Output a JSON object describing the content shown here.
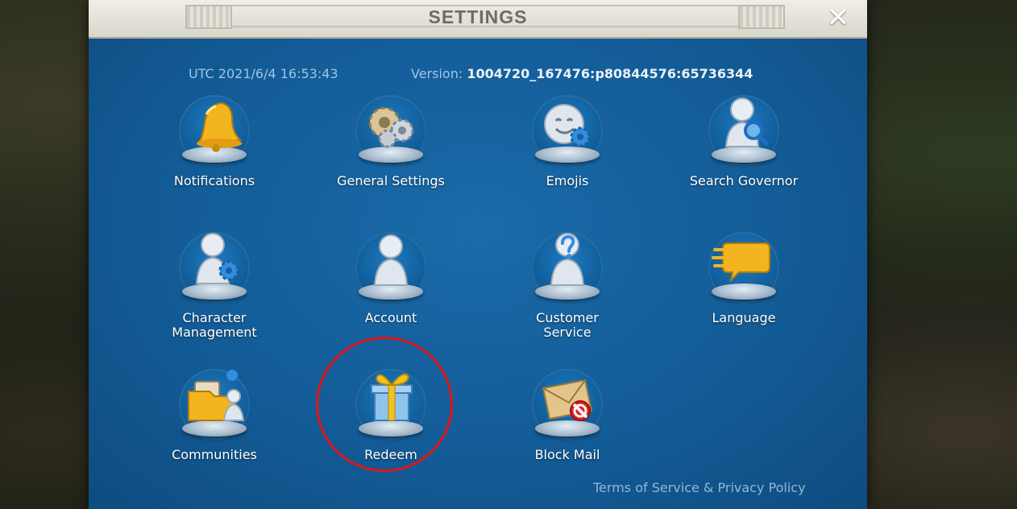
{
  "dialog": {
    "title": "SETTINGS",
    "close_label": "✕",
    "utc_text": "UTC 2021/6/4 16:53:43",
    "version_label": "Version: ",
    "version_value": "1004720_167476:p80844576:65736344",
    "footer_link": "Terms of Service & Privacy Policy"
  },
  "tiles": [
    {
      "icon": "bell-icon",
      "label": "Notifications"
    },
    {
      "icon": "gears-icon",
      "label": "General Settings"
    },
    {
      "icon": "smiley-icon",
      "label": "Emojis"
    },
    {
      "icon": "search-governor-icon",
      "label": "Search Governor"
    },
    {
      "icon": "character-gear-icon",
      "label_line1": "Character",
      "label_line2": "Management"
    },
    {
      "icon": "account-icon",
      "label": "Account"
    },
    {
      "icon": "customer-service-icon",
      "label_line1": "Customer",
      "label_line2": "Service"
    },
    {
      "icon": "speech-bubble-icon",
      "label": "Language"
    },
    {
      "icon": "communities-icon",
      "label": "Communities"
    },
    {
      "icon": "gift-icon",
      "label": "Redeem"
    },
    {
      "icon": "blocked-mail-icon",
      "label": "Block Mail"
    }
  ],
  "colors": {
    "panel": "#135c97",
    "titlebar": "#e6e4da",
    "highlight": "#e0141a",
    "version_value": "#e8f2fb"
  }
}
